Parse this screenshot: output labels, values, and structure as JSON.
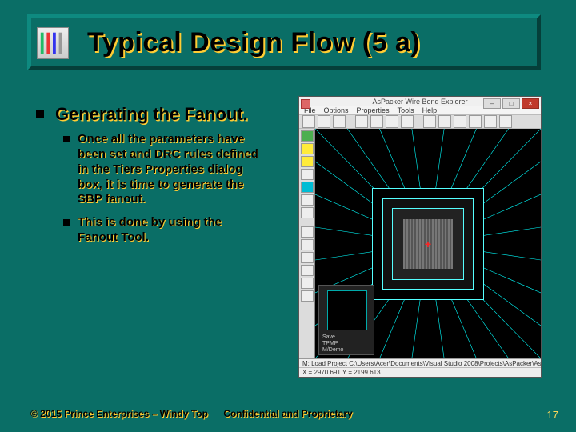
{
  "title": "Typical Design Flow (5 a)",
  "heading": "Generating the Fanout.",
  "sub_bullets": [
    "Once all the parameters have been set and DRC rules defined in the Tiers Properties dialog box, it is time to generate the SBP fanout.",
    "This is done by using the Fanout Tool."
  ],
  "app_window": {
    "title": "AsPacker Wire Bond Explorer",
    "menus": [
      "File",
      "Options",
      "Properties",
      "Tools",
      "Help"
    ],
    "status1": "M: Load Project  C:\\Users\\Acer\\Documents\\Visual Studio 2008\\Projects\\AsPacker\\AsPackerRCep…",
    "status2": "X = 2970.691       Y = 2199.613",
    "nav_labels": "Save\nTPMP\nM/Demo"
  },
  "footer": {
    "left": "© 2015 Prince Enterprises – Windy Top",
    "center": "Confidential and Proprietary",
    "page": "17"
  }
}
